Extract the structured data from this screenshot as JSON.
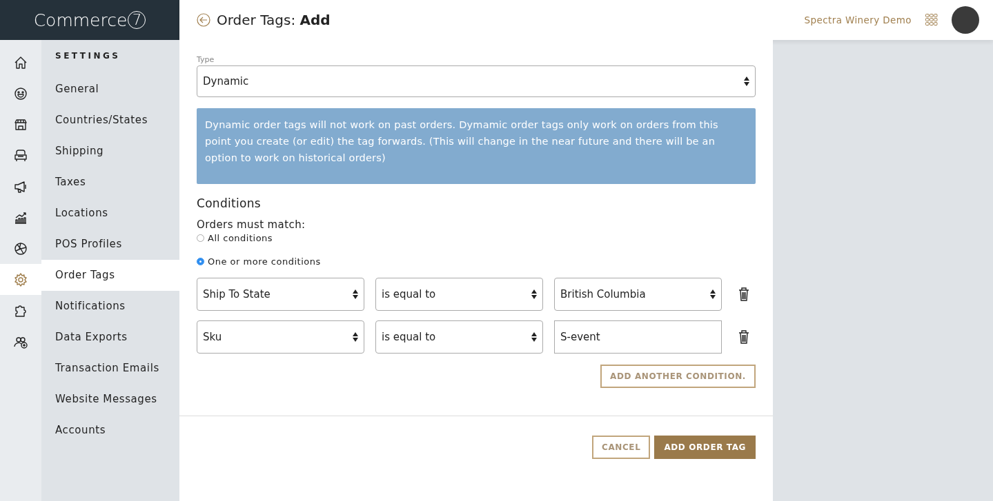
{
  "brand": {
    "name": "Commerce",
    "mark": "7"
  },
  "header": {
    "title": "Order Tags: ",
    "title_bold": "Add",
    "account": "Spectra Winery Demo"
  },
  "rail": [
    {
      "kind": "home",
      "selected": false
    },
    {
      "kind": "smiley",
      "selected": false
    },
    {
      "kind": "store",
      "selected": false
    },
    {
      "kind": "sofa",
      "selected": false
    },
    {
      "kind": "megaphone",
      "selected": false
    },
    {
      "kind": "chart",
      "selected": false
    },
    {
      "kind": "aperture",
      "selected": false
    },
    {
      "kind": "gear",
      "selected": true
    },
    {
      "kind": "puzzle",
      "selected": false
    },
    {
      "kind": "users",
      "selected": false
    }
  ],
  "menu": {
    "heading": "SETTINGS",
    "items": [
      {
        "label": "General",
        "selected": false
      },
      {
        "label": "Countries/States",
        "selected": false
      },
      {
        "label": "Shipping",
        "selected": false
      },
      {
        "label": "Taxes",
        "selected": false
      },
      {
        "label": "Locations",
        "selected": false
      },
      {
        "label": "POS Profiles",
        "selected": false
      },
      {
        "label": "Order Tags",
        "selected": true
      },
      {
        "label": "Notifications",
        "selected": false
      },
      {
        "label": "Data Exports",
        "selected": false
      },
      {
        "label": "Transaction Emails",
        "selected": false
      },
      {
        "label": "Website Messages",
        "selected": false
      },
      {
        "label": "Accounts",
        "selected": false
      }
    ]
  },
  "form": {
    "type_label": "Type",
    "type_value": "Dynamic",
    "notice": "Dynamic order tags will not work on past orders. Dymamic order tags only work on orders from this point you create (or edit) the tag forwards. (This will change in the near future and there will be an option to work on historical orders)",
    "conditions_heading": "Conditions",
    "match_label": "Orders must match:",
    "match_options": [
      {
        "label": "All conditions",
        "selected": false
      },
      {
        "label": "One or more conditions",
        "selected": true
      }
    ],
    "conditions": [
      {
        "fields": [
          {
            "kind": "select",
            "value": "Ship To State"
          },
          {
            "kind": "select",
            "value": "is equal to"
          },
          {
            "kind": "select",
            "value": "British Columbia"
          }
        ]
      },
      {
        "fields": [
          {
            "kind": "select",
            "value": "Sku"
          },
          {
            "kind": "select",
            "value": "is equal to"
          },
          {
            "kind": "text",
            "value": "S-event"
          }
        ]
      }
    ],
    "add_condition": "ADD ANOTHER CONDITION.",
    "cancel": "CANCEL",
    "submit": "ADD ORDER TAG"
  }
}
